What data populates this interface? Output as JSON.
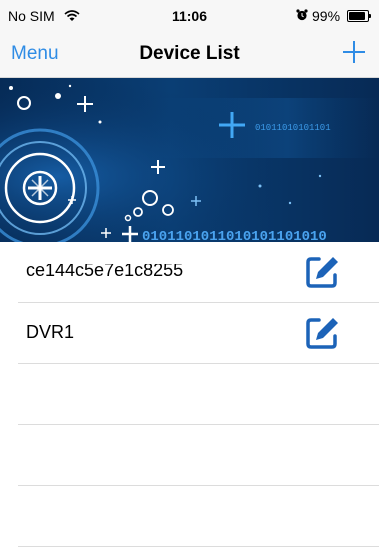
{
  "status_bar": {
    "carrier": "No SIM",
    "time": "11:06",
    "battery": "99%"
  },
  "nav": {
    "menu_label": "Menu",
    "title": "Device List"
  },
  "banner": {
    "binary_text": "0101101011010101101010",
    "binary_text_small": "01011010101101"
  },
  "devices": [
    {
      "name": "ce144c5e7e1c8255"
    },
    {
      "name": "DVR1"
    }
  ],
  "colors": {
    "accent": "#2f8ce5",
    "edit_icon": "#1c63b8",
    "banner_dark": "#062b57"
  }
}
